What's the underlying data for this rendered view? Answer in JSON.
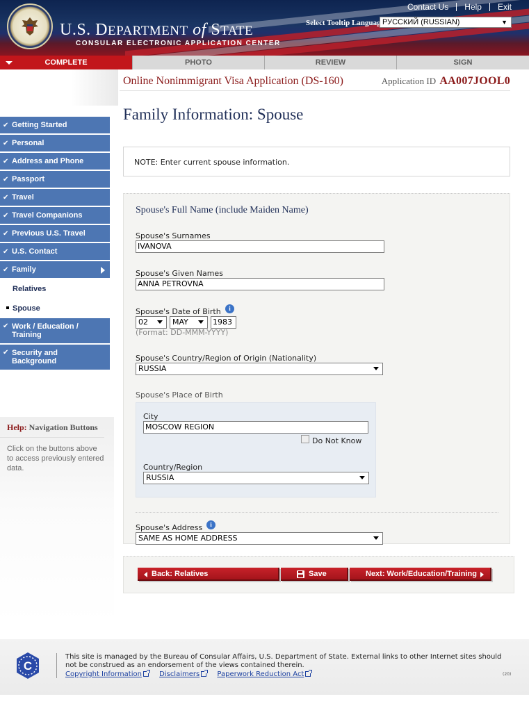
{
  "header": {
    "top_links": [
      "Contact Us",
      "Help",
      "Exit"
    ],
    "dept_prefix": "U.S. D",
    "dept_small1": "EPARTMENT",
    "dept_of": "of",
    "dept_s": "S",
    "dept_small2": "TATE",
    "subtitle": "CONSULAR ELECTRONIC APPLICATION CENTER",
    "tooltip_language_label": "Select Tooltip Language",
    "tooltip_language_value": "РУССКИЙ (RUSSIAN)"
  },
  "progress_steps": [
    {
      "label": "COMPLETE",
      "active": true
    },
    {
      "label": "PHOTO",
      "active": false
    },
    {
      "label": "REVIEW",
      "active": false
    },
    {
      "label": "SIGN",
      "active": false
    }
  ],
  "app": {
    "title": "Online Nonimmigrant Visa Application (DS-160)",
    "id_label": "Application ID",
    "id_value": "AA007JOOL0"
  },
  "page_heading": "Family Information: Spouse",
  "sidenav": {
    "items": [
      {
        "label": "Getting Started"
      },
      {
        "label": "Personal"
      },
      {
        "label": "Address and Phone"
      },
      {
        "label": "Passport"
      },
      {
        "label": "Travel"
      },
      {
        "label": "Travel Companions"
      },
      {
        "label": "Previous U.S. Travel"
      },
      {
        "label": "U.S. Contact"
      },
      {
        "label": "Family"
      }
    ],
    "sub_relatives": "Relatives",
    "sub_spouse": "Spouse",
    "work_line1": "Work / Education /",
    "work_line2": "Training",
    "security_line1": "Security and",
    "security_line2": "Background"
  },
  "help": {
    "title_prefix": "Help:",
    "title_rest": " Navigation Buttons",
    "text": "Click on the buttons above to access previously entered data."
  },
  "note": "NOTE: Enter current spouse information.",
  "form": {
    "section_title": "Spouse's Full Name (include Maiden Name)",
    "surnames_label": "Spouse's Surnames",
    "surnames_value": "IVANOVA",
    "given_label": "Spouse's Given Names",
    "given_value": "ANNA PETROVNA",
    "dob_label": "Spouse's Date of Birth",
    "dob_day": "02",
    "dob_month": "MAY",
    "dob_year": "1983",
    "dob_format": "(Format: DD-MMM-YYYY)",
    "country_label": "Spouse's Country/Region of Origin (Nationality)",
    "country_value": "RUSSIA",
    "pob_label": "Spouse's Place of Birth",
    "city_label": "City",
    "city_value": "MOSCOW REGION",
    "do_not_know": "Do Not Know",
    "pob_country_label": "Country/Region",
    "pob_country_value": "RUSSIA",
    "address_label": "Spouse's Address",
    "address_value": "SAME AS HOME ADDRESS"
  },
  "buttons": {
    "back": "Back: Relatives",
    "save": "Save",
    "next": "Next: Work/Education/Training"
  },
  "footer": {
    "text": "This site is managed by the Bureau of Consular Affairs, U.S. Department of State. External links to other Internet sites should not be construed as an endorsement of the views contained therein.",
    "links": [
      "Copyright Information",
      "Disclaimers",
      "Paperwork Reduction Act"
    ],
    "code": "(20)"
  },
  "colors": {
    "nav_blue": "#4d76b3",
    "brand_red": "#c2161b",
    "heading_navy": "#1f2e57",
    "title_maroon": "#8b1a1a"
  }
}
